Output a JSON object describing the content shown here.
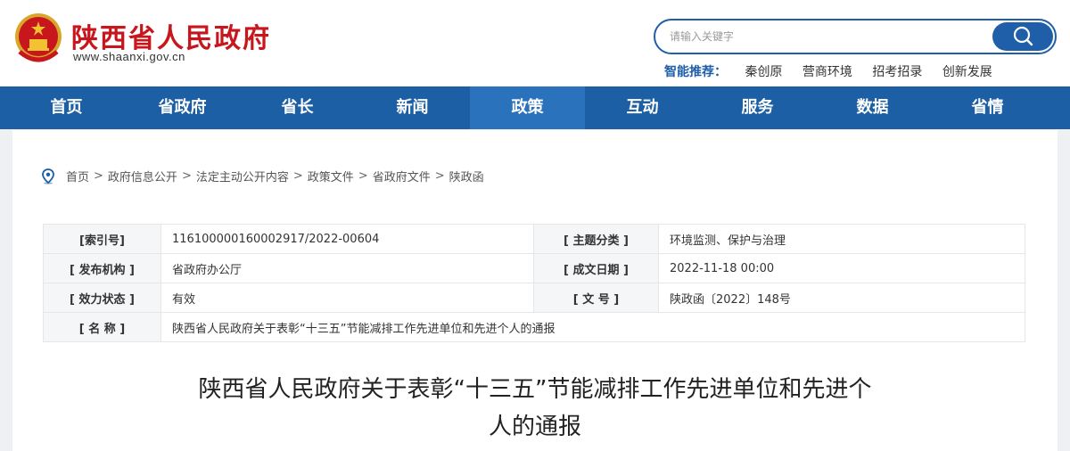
{
  "header": {
    "site_title": "陕西省人民政府",
    "site_url": "www.shaanxi.gov.cn",
    "search_placeholder": "请输入关键字",
    "smart_recommend_label": "智能推荐：",
    "smart_recommend_links": [
      "秦创原",
      "营商环境",
      "招考招录",
      "创新发展"
    ]
  },
  "nav": {
    "items": [
      "首页",
      "省政府",
      "省长",
      "新闻",
      "政策",
      "互动",
      "服务",
      "数据",
      "省情"
    ],
    "active": "政策"
  },
  "breadcrumb": [
    "首页",
    "政府信息公开",
    "法定主动公开内容",
    "政策文件",
    "省政府文件",
    "陕政函"
  ],
  "breadcrumb_sep": ">",
  "info_table": {
    "index_label": "[索引号]",
    "index_value": "11610000016000291​7/2022-00604",
    "topic_label": "[ 主题分类 ]",
    "topic_value": "环境监测、保护与治理",
    "org_label": "[ 发布机构 ]",
    "org_value": "省政府办公厅",
    "date_label": "[ 成文日期 ]",
    "date_value": "2022-11-18 00:00",
    "status_label": "[ 效力状态 ]",
    "status_value": "有效",
    "docno_label": "[ 文 号 ]",
    "docno_value": "陕政函〔2022〕148号",
    "name_label": "[ 名 称 ]",
    "name_value": "陕西省人民政府关于表彰“十三五”节能减排工作先进单位和先进个人的通报"
  },
  "document": {
    "title_line1": "陕西省人民政府关于表彰“十三五”节能减排工作先进单位和先进个",
    "title_line2": "人的通报"
  },
  "colors": {
    "brand_red": "#c8161d",
    "nav_blue": "#1d5fa4",
    "nav_active": "#2b72bd"
  }
}
